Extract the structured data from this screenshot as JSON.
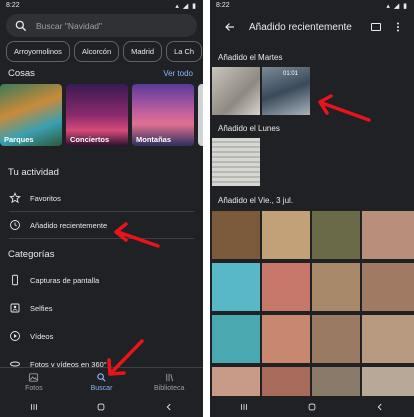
{
  "colors": {
    "accent": "#8ab4f8",
    "background": "#202124",
    "arrow": "#e8141b"
  },
  "left": {
    "status_time": "8:22",
    "search_placeholder": "Buscar \"Navidad\"",
    "chips": [
      "Arroyomolinos",
      "Alcorcón",
      "Madrid",
      "La Ch"
    ],
    "things_title": "Cosas",
    "see_all": "Ver todo",
    "things": [
      {
        "label": "Parques"
      },
      {
        "label": "Conciertos"
      },
      {
        "label": "Montañas"
      }
    ],
    "activity_title": "Tu actividad",
    "activity": [
      {
        "label": "Favoritos",
        "icon": "star-icon"
      },
      {
        "label": "Añadido recientemente",
        "icon": "clock-icon"
      }
    ],
    "categories_title": "Categorías",
    "categories": [
      {
        "label": "Capturas de pantalla",
        "icon": "phone-icon"
      },
      {
        "label": "Selfies",
        "icon": "selfie-icon"
      },
      {
        "label": "Vídeos",
        "icon": "play-icon"
      },
      {
        "label": "Fotos y vídeos en 360°",
        "icon": "360-icon"
      }
    ],
    "nav": [
      {
        "label": "Fotos",
        "icon": "photo-icon"
      },
      {
        "label": "Buscar",
        "icon": "search-icon"
      },
      {
        "label": "Biblioteca",
        "icon": "library-icon"
      }
    ]
  },
  "right": {
    "status_time": "8:22",
    "title": "Añadido recientemente",
    "groups": [
      {
        "label": "Añadido el Martes"
      },
      {
        "label": "Añadido el Lunes"
      },
      {
        "label": "Añadido el Vie., 3 jul."
      }
    ],
    "video_time": "01:01"
  }
}
